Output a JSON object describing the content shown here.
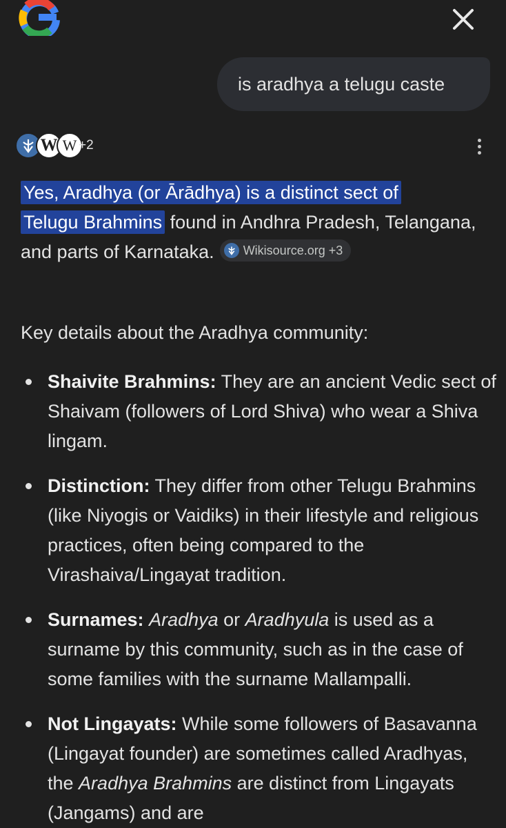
{
  "header": {
    "logo_icon": "google-g-icon",
    "close_icon": "close-icon"
  },
  "query": {
    "text": "is aradhya a telugu caste"
  },
  "sources": {
    "icons": [
      "wikisource-icon",
      "wikipedia-icon",
      "wiktionary-icon"
    ],
    "more_count": "+2",
    "menu_icon": "more-vert-icon"
  },
  "answer": {
    "highlighted_1": "Yes, Aradhya (or Ārādhya) is a distinct sect of",
    "highlighted_2": "Telugu Brahmins",
    "rest": " found in Andhra Pradesh, Telangana, and parts of Karnataka.",
    "citation_chip": "Wikisource.org +3"
  },
  "details": {
    "lead": "Key details about the Aradhya community:",
    "items": [
      {
        "title": "Shaivite Brahmins:",
        "text": " They are an ancient Vedic sect of Shaivam (followers of Lord Shiva) who wear a Shiva lingam."
      },
      {
        "title": "Distinction:",
        "text": " They differ from other Telugu Brahmins (like Niyogis or Vaidiks) in their lifestyle and religious practices, often being compared to the Virashaiva/Lingayat tradition."
      },
      {
        "title": "Surnames:",
        "em1": "Aradhya",
        "mid": " or ",
        "em2": "Aradhyula",
        "text": " is used as a surname by this community, such as in the case of some families with the surname Mallampalli."
      },
      {
        "title": "Not Lingayats:",
        "text_a": " While some followers of Basavanna (Lingayat founder) are sometimes called Aradhyas, the ",
        "em": "Aradhya Brahmins",
        "text_b": " are distinct from Lingayats (Jangams) and are"
      }
    ]
  },
  "colors": {
    "background": "#1f1f1f",
    "bubble": "#2c2e33",
    "highlight": "#22439b",
    "text": "#e3e3e3"
  }
}
